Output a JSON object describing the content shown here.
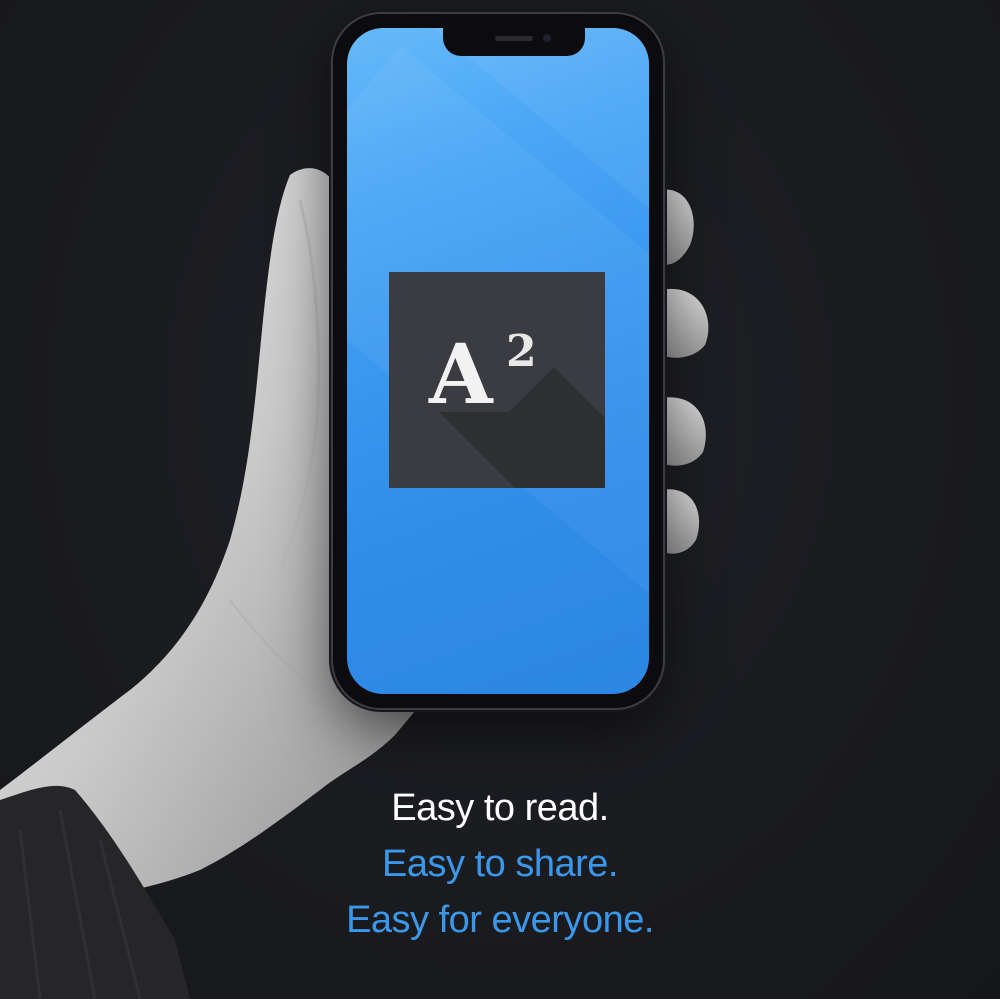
{
  "logo": {
    "letter": "A",
    "superscript": "2"
  },
  "taglines": [
    "Easy to read.",
    "Easy to share.",
    "Easy for everyone."
  ],
  "colors": {
    "background": "#1b1c20",
    "screen": "#3a98f0",
    "logo_tile": "#3b3c41",
    "tagline_primary": "#ffffff",
    "tagline_accent": "#3b97ea"
  }
}
